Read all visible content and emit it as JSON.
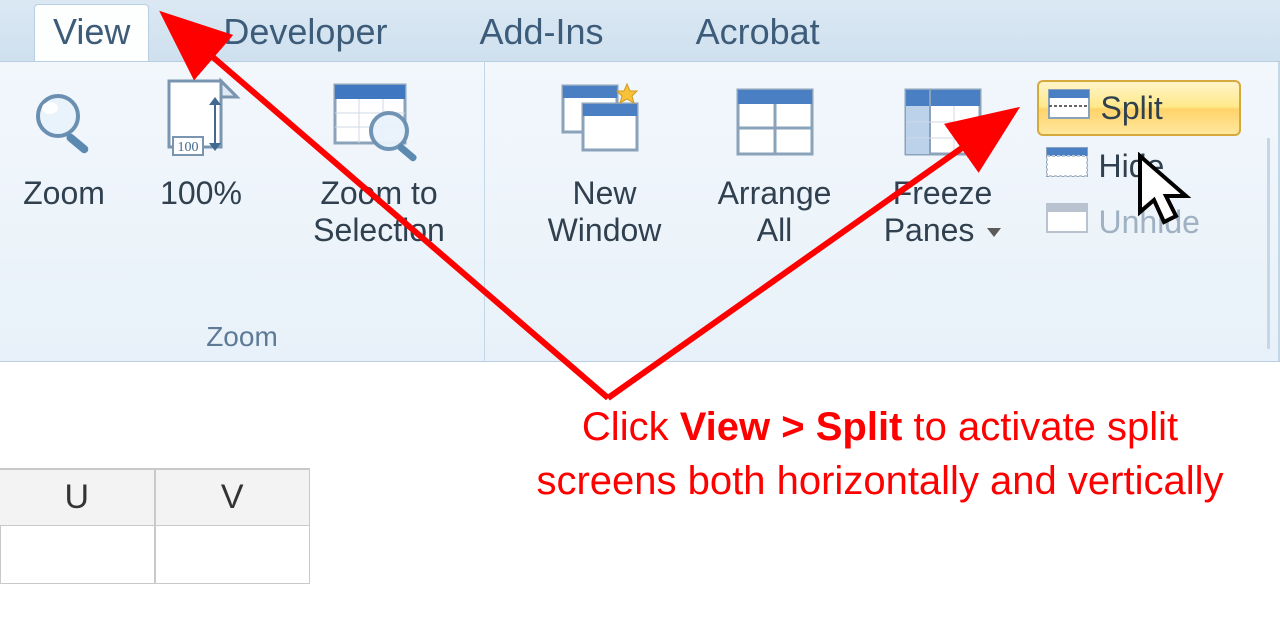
{
  "tabs": {
    "view": "View",
    "developer": "Developer",
    "addins": "Add-Ins",
    "acrobat": "Acrobat"
  },
  "ribbon": {
    "zoom_group_label": "Zoom",
    "zoom": "Zoom",
    "hundred": "100%",
    "zoom_to_selection_l1": "Zoom to",
    "zoom_to_selection_l2": "Selection",
    "new_window_l1": "New",
    "new_window_l2": "Window",
    "arrange_all_l1": "Arrange",
    "arrange_all_l2": "All",
    "freeze_panes_l1": "Freeze",
    "freeze_panes_l2": "Panes",
    "split": "Split",
    "hide": "Hide",
    "unhide": "Unhide"
  },
  "sheet": {
    "columns": [
      "U",
      "V"
    ]
  },
  "annotation": {
    "prefix": "Click ",
    "bold": "View > Split",
    "suffix": " to activate split screens both horizontally and vertically"
  },
  "colors": {
    "annotation": "#ff0000",
    "ribbon_bg": "#e8f1f9",
    "highlight_border": "#d6a93c"
  }
}
